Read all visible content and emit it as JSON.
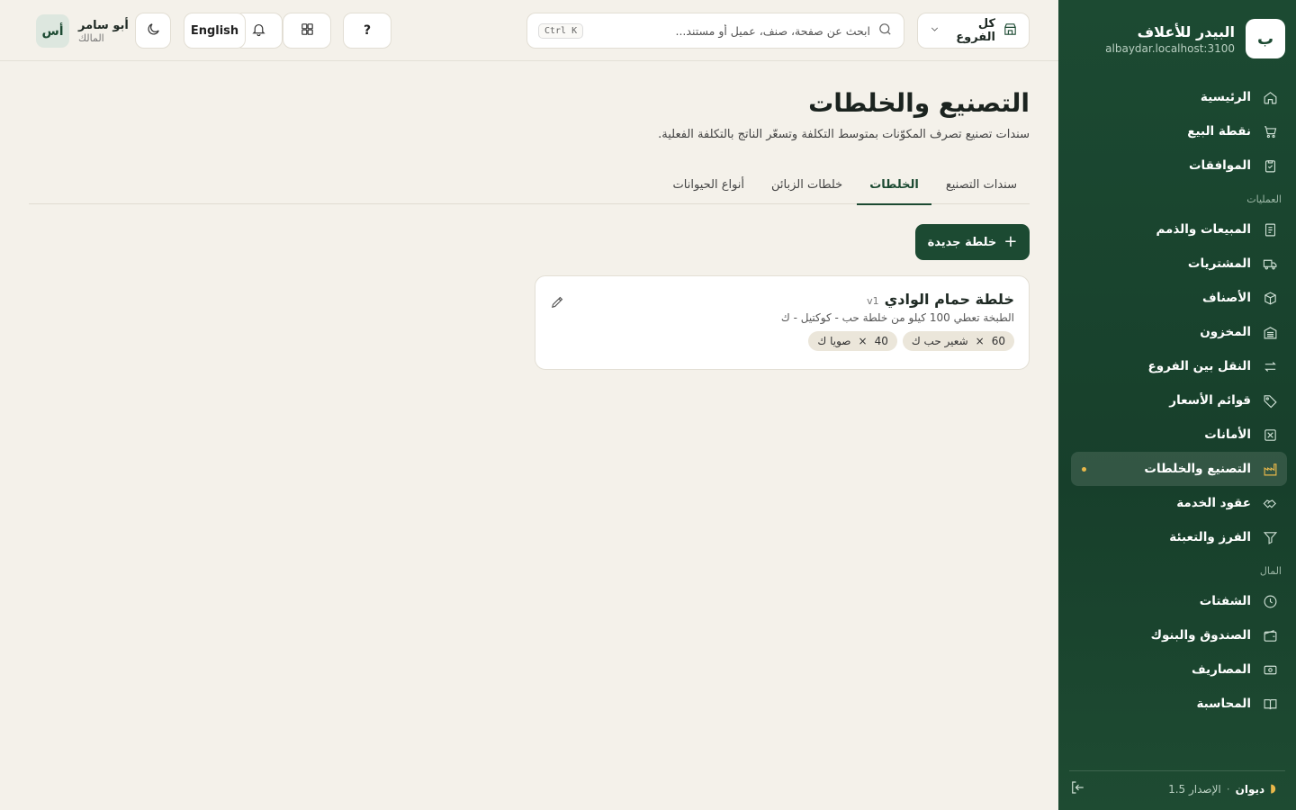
{
  "sidebar": {
    "brand": {
      "logo_letter": "ب",
      "name": "البيدر للأعلاف",
      "domain": "albaydar.localhost:3100"
    },
    "items": [
      {
        "label": "الرئيسية",
        "icon": "home-icon"
      },
      {
        "label": "نقطة البيع",
        "icon": "cart-icon"
      },
      {
        "label": "الموافقات",
        "icon": "clipboard-check-icon"
      }
    ],
    "section_operations": "العمليات",
    "operations": [
      {
        "label": "المبيعات والذمم",
        "icon": "receipt-icon"
      },
      {
        "label": "المشتريات",
        "icon": "truck-icon"
      },
      {
        "label": "الأصناف",
        "icon": "box-icon"
      },
      {
        "label": "المخزون",
        "icon": "warehouse-icon"
      },
      {
        "label": "النقل بين الفروع",
        "icon": "transfer-icon"
      },
      {
        "label": "قوائم الأسعار",
        "icon": "tag-icon"
      },
      {
        "label": "الأمانات",
        "icon": "deposit-icon"
      },
      {
        "label": "التصنيع والخلطات",
        "icon": "factory-icon",
        "active": true
      },
      {
        "label": "عقود الخدمة",
        "icon": "handshake-icon"
      },
      {
        "label": "الفرز والتعبئة",
        "icon": "filter-icon"
      }
    ],
    "section_money": "المال",
    "money": [
      {
        "label": "الشفتات",
        "icon": "clock-icon"
      },
      {
        "label": "الصندوق والبنوك",
        "icon": "wallet-icon"
      },
      {
        "label": "المصاريف",
        "icon": "cash-icon"
      },
      {
        "label": "المحاسبة",
        "icon": "book-icon"
      }
    ],
    "footer": {
      "brand": "ديوان",
      "version": "الإصدار 1.5",
      "separator": "·"
    }
  },
  "topbar": {
    "branch": "كل الفروع",
    "search_placeholder": "ابحث عن صفحة، صنف، عميل أو مستند...",
    "search_shortcut": "Ctrl K",
    "help_label": "?",
    "language_label": "English",
    "user": {
      "initials": "أس",
      "name": "أبو سامر",
      "role": "المالك"
    }
  },
  "main": {
    "title": "التصنيع والخلطات",
    "subtitle": "سندات تصنيع تصرف المكوّنات بمتوسط التكلفة وتسعّر الناتج بالتكلفة الفعلية.",
    "tabs": [
      {
        "label": "سندات التصنيع"
      },
      {
        "label": "الخلطات",
        "active": true
      },
      {
        "label": "خلطات الزبائن"
      },
      {
        "label": "أنواع الحيوانات"
      }
    ],
    "new_button": "خلطة جديدة",
    "recipes": [
      {
        "name": "خلطة حمام الوادي",
        "version": "v1",
        "description": "الطبخة تعطي 100 كيلو من خلطة حب - كوكتيل - ك",
        "ingredients": [
          {
            "qty": "60",
            "times": "×",
            "name": "شعير حب ك"
          },
          {
            "qty": "40",
            "times": "×",
            "name": "صويا ك"
          }
        ]
      }
    ]
  }
}
